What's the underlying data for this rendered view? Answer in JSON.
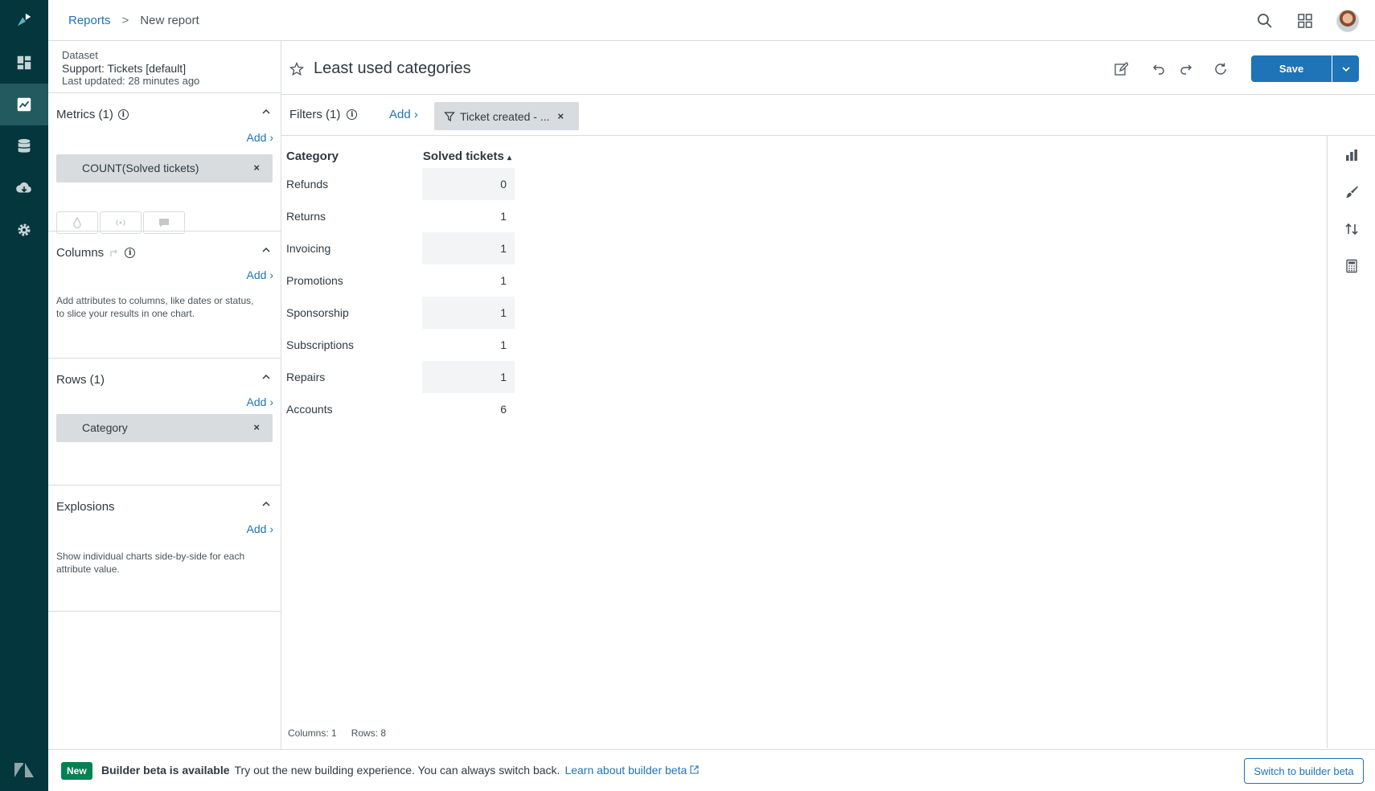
{
  "nav": {
    "items": [
      "dashboard-icon",
      "reports-icon",
      "dataset-icon",
      "download-icon",
      "settings-icon"
    ],
    "active": "reports-icon"
  },
  "header": {
    "breadcrumb_link": "Reports",
    "breadcrumb_sep": ">",
    "breadcrumb_current": "New report"
  },
  "dataset": {
    "label": "Dataset",
    "name": "Support: Tickets [default]",
    "updated": "Last updated: 28 minutes ago"
  },
  "config": {
    "metrics": {
      "title": "Metrics (1)",
      "add": "Add ›",
      "pill": "COUNT(Solved tickets)"
    },
    "columns": {
      "title": "Columns",
      "add": "Add ›",
      "hint": "Add attributes to columns, like dates or status, to slice your results in one chart."
    },
    "rows": {
      "title": "Rows (1)",
      "add": "Add ›",
      "pill": "Category"
    },
    "explosions": {
      "title": "Explosions",
      "add": "Add ›",
      "hint": "Show individual charts side-by-side for each attribute value."
    },
    "remove_glyph": "×"
  },
  "report": {
    "title": "Least used categories",
    "save_label": "Save"
  },
  "filters": {
    "label": "Filters (1)",
    "add": "Add ›",
    "pill": "Ticket created - ..."
  },
  "table": {
    "col_category": "Category",
    "col_value": "Solved tickets",
    "sort_glyph": "▴",
    "rows": [
      {
        "category": "Refunds",
        "value": "0"
      },
      {
        "category": "Returns",
        "value": "1"
      },
      {
        "category": "Invoicing",
        "value": "1"
      },
      {
        "category": "Promotions",
        "value": "1"
      },
      {
        "category": "Sponsorship",
        "value": "1"
      },
      {
        "category": "Subscriptions",
        "value": "1"
      },
      {
        "category": "Repairs",
        "value": "1"
      },
      {
        "category": "Accounts",
        "value": "6"
      }
    ],
    "stats_columns": "Columns: 1",
    "stats_rows": "Rows: 8"
  },
  "banner": {
    "badge": "New",
    "headline": "Builder beta is available",
    "body": "Try out the new building experience. You can always switch back.",
    "link": "Learn about builder beta",
    "button": "Switch to builder beta"
  },
  "colors": {
    "nav_bg": "#03363d",
    "accent": "#1f73b7",
    "badge": "#038153"
  }
}
